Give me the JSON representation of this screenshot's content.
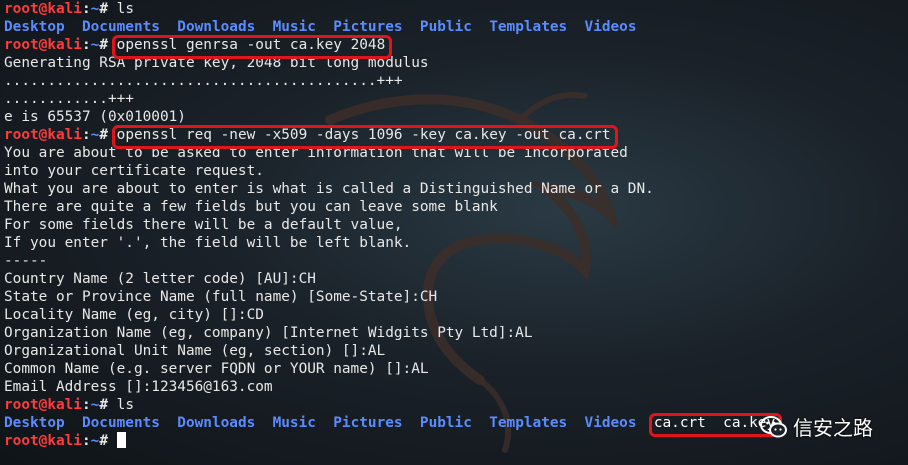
{
  "prompt": {
    "user": "root@kali",
    "colon": ":",
    "dir": "~",
    "symbol": "# "
  },
  "lines": [
    {
      "type": "prompt",
      "command": "ls"
    },
    {
      "type": "ls",
      "dirs": [
        "Desktop",
        "Documents",
        "Downloads",
        "Music",
        "Pictures",
        "Public",
        "Templates",
        "Videos"
      ],
      "files": []
    },
    {
      "type": "prompt",
      "command": "openssl genrsa -out ca.key 2048",
      "highlighted": true
    },
    {
      "type": "text",
      "text": "Generating RSA private key, 2048 bit long modulus"
    },
    {
      "type": "text",
      "text": "...........................................+++"
    },
    {
      "type": "text",
      "text": "............+++"
    },
    {
      "type": "text",
      "text": "e is 65537 (0x010001)"
    },
    {
      "type": "prompt",
      "command": "openssl req -new -x509 -days 1096 -key ca.key -out ca.crt",
      "highlighted": true
    },
    {
      "type": "text",
      "text": "You are about to be asked to enter information that will be incorporated"
    },
    {
      "type": "text",
      "text": "into your certificate request."
    },
    {
      "type": "text",
      "text": "What you are about to enter is what is called a Distinguished Name or a DN."
    },
    {
      "type": "text",
      "text": "There are quite a few fields but you can leave some blank"
    },
    {
      "type": "text",
      "text": "For some fields there will be a default value,"
    },
    {
      "type": "text",
      "text": "If you enter '.', the field will be left blank."
    },
    {
      "type": "text",
      "text": "-----"
    },
    {
      "type": "text",
      "text": "Country Name (2 letter code) [AU]:CH"
    },
    {
      "type": "text",
      "text": "State or Province Name (full name) [Some-State]:CH"
    },
    {
      "type": "text",
      "text": "Locality Name (eg, city) []:CD"
    },
    {
      "type": "text",
      "text": "Organization Name (eg, company) [Internet Widgits Pty Ltd]:AL"
    },
    {
      "type": "text",
      "text": "Organizational Unit Name (eg, section) []:AL"
    },
    {
      "type": "text",
      "text": "Common Name (e.g. server FQDN or YOUR name) []:AL"
    },
    {
      "type": "text",
      "text": "Email Address []:123456@163.com"
    },
    {
      "type": "prompt",
      "command": "ls"
    },
    {
      "type": "ls",
      "dirs": [
        "Desktop",
        "Documents",
        "Downloads",
        "Music",
        "Pictures",
        "Public",
        "Templates",
        "Videos"
      ],
      "files": [
        "ca.crt",
        "ca.key"
      ],
      "highlight_files": true
    },
    {
      "type": "prompt",
      "command": "",
      "cursor": true
    }
  ],
  "watermark": {
    "text": "信安之路",
    "icon": "wechat-icon"
  },
  "colors": {
    "user": "#ff3b3b",
    "directory": "#5b8cff",
    "highlight_box": "#e0141b"
  }
}
